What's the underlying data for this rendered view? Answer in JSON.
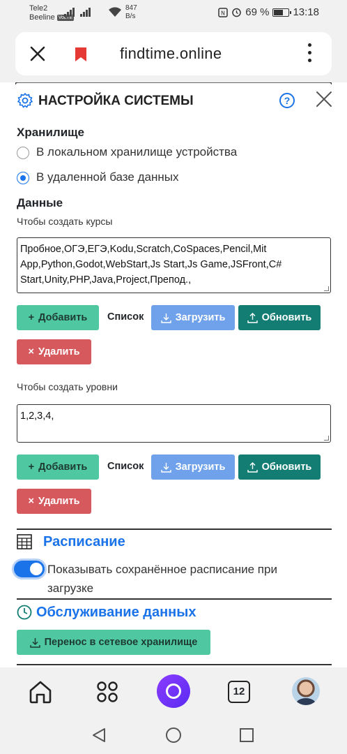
{
  "status_bar": {
    "carrier1": "Tele2",
    "carrier2": "Beeline",
    "volte": "VoLTE",
    "speed_value": "847",
    "speed_unit": "B/s",
    "battery": "69 %",
    "battery_level": 0.69,
    "time": "13:18"
  },
  "browser": {
    "url": "findtime.online"
  },
  "settings": {
    "title": "НАСТРОЙКА СИСТЕМЫ",
    "help": "?",
    "storage_heading": "Хранилище",
    "storage_options": [
      {
        "label": "В локальном хранилище устройства",
        "selected": false
      },
      {
        "label": "В удаленной базе данных",
        "selected": true
      }
    ],
    "data_heading": "Данные",
    "courses": {
      "caption": "Чтобы создать курсы",
      "value": "Пробное,ОГЭ,ЕГЭ,Kodu,Scratch,CoSpaces,Pencil,Mit App,Python,Godot,WebStart,Js Start,Js Game,JSFront,C# Start,Unity,PHP,Java,Project,Препод.,"
    },
    "levels": {
      "caption": "Чтобы создать уровни",
      "value": "1,2,3,4,"
    },
    "buttons": {
      "add": "Добавить",
      "list": "Список",
      "load": "Загрузить",
      "update": "Обновить",
      "delete": "Удалить"
    },
    "schedule_heading": "Расписание",
    "show_saved_schedule": "Показывать сохранённое расписание при загрузке",
    "show_saved_schedule_on": true,
    "maintenance_heading": "Обслуживание данных",
    "transfer_button": "Перенос в сетевое хранилище"
  },
  "bottom_nav": {
    "tabs_count": "12"
  },
  "colors": {
    "accent": "#1a73e8",
    "add": "#4fc8a2",
    "load": "#6fa2ea",
    "update": "#137d74",
    "delete": "#d6595e"
  }
}
